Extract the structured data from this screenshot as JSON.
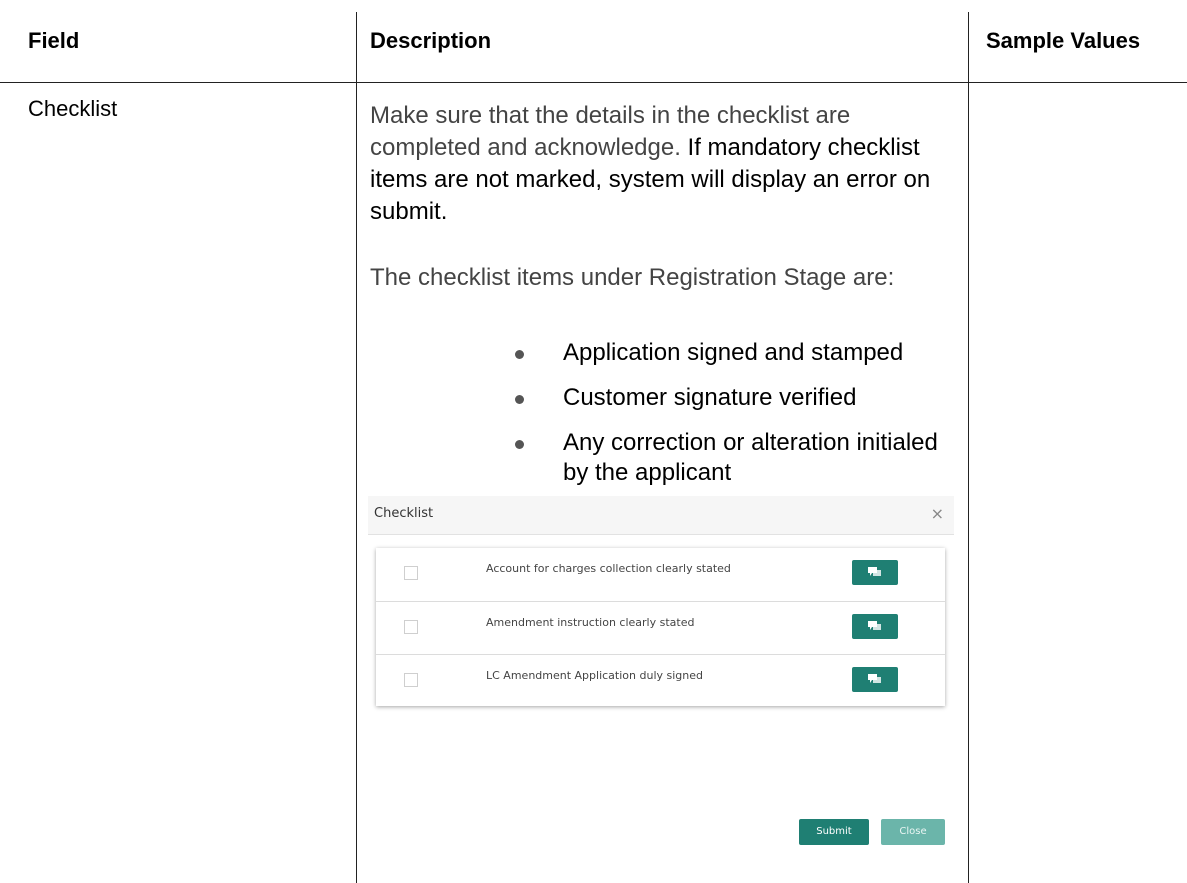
{
  "table": {
    "headers": [
      "Field",
      "Description",
      "Sample Values"
    ],
    "row": {
      "field": "Checklist",
      "para1_grey": "Make sure that the details in the checklist are completed and acknowledge.",
      "para1_black": " If mandatory checklist items are not marked, system will display an error on submit.",
      "para2": "The checklist items under Registration Stage are:",
      "bullets": [
        "Application signed and stamped",
        "Customer signature verified",
        "Any correction or alteration initialed by the applicant"
      ]
    }
  },
  "dialog": {
    "title": "Checklist",
    "close_symbol": "×",
    "items": [
      {
        "label": "Account for charges collection clearly stated",
        "icon": "comment-icon"
      },
      {
        "label": "Amendment instruction clearly stated",
        "icon": "comment-icon"
      },
      {
        "label": "LC Amendment Application duly signed",
        "icon": "comment-icon"
      }
    ],
    "submit_label": "Submit",
    "close_label": "Close",
    "colors": {
      "primary": "#1f7f73",
      "primary_light": "#6bb5aa"
    }
  }
}
